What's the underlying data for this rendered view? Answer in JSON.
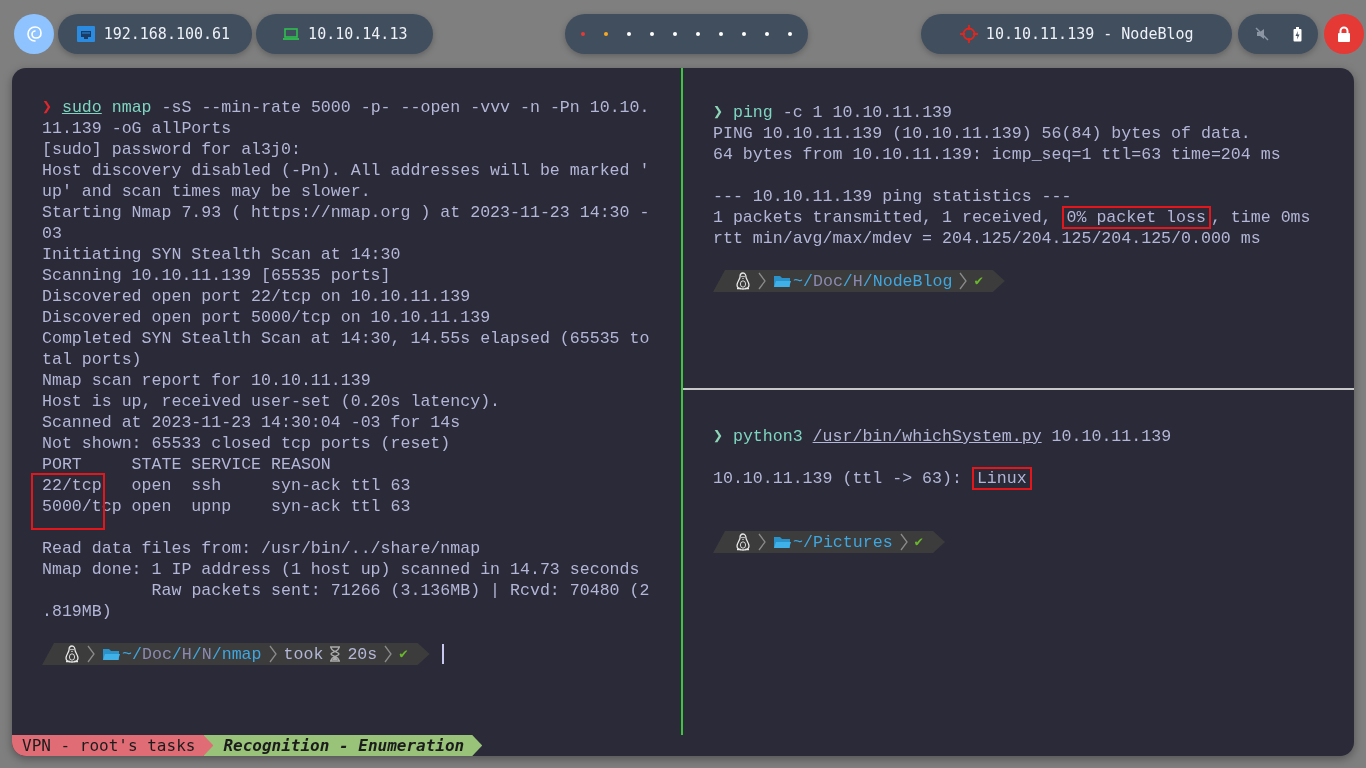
{
  "topbar": {
    "ip_address": "192.168.100.61",
    "vpn_address": "10.10.14.13",
    "workspaces": [
      {
        "color": "#e53935"
      },
      {
        "color": "#f9a825"
      },
      {
        "color": "#ffffff"
      },
      {
        "color": "#ffffff"
      },
      {
        "color": "#ffffff"
      },
      {
        "color": "#ffffff"
      },
      {
        "color": "#ffffff"
      },
      {
        "color": "#ffffff"
      },
      {
        "color": "#ffffff"
      },
      {
        "color": "#ffffff"
      }
    ],
    "target": "10.10.11.139 - NodeBlog"
  },
  "panes": [
    {
      "lines": [
        {
          "kind": "command",
          "prompt": "❯",
          "color": "#e0262b",
          "tokens": [
            {
              "kind": "cmd_link",
              "text": "sudo"
            },
            {
              "kind": "cmd",
              "text": "nmap"
            },
            {
              "kind": "arg",
              "text": "-sS --min-rate 5000 -p- --open -vvv -n -Pn 10.10.11.139 -oG allPorts"
            }
          ]
        },
        {
          "kind": "text",
          "text": "[sudo] password for al3j0:"
        },
        {
          "kind": "text",
          "text": "Host discovery disabled (-Pn). All addresses will be marked 'up' and scan times may be slower."
        },
        {
          "kind": "text",
          "text": "Starting Nmap 7.93 ( https://nmap.org ) at 2023-11-23 14:30 -03"
        },
        {
          "kind": "text",
          "text": "Initiating SYN Stealth Scan at 14:30"
        },
        {
          "kind": "text",
          "text": "Scanning 10.10.11.139 [65535 ports]"
        },
        {
          "kind": "text",
          "text": "Discovered open port 22/tcp on 10.10.11.139"
        },
        {
          "kind": "text",
          "text": "Discovered open port 5000/tcp on 10.10.11.139"
        },
        {
          "kind": "text",
          "text": "Completed SYN Stealth Scan at 14:30, 14.55s elapsed (65535 total ports)"
        },
        {
          "kind": "text",
          "text": "Nmap scan report for 10.10.11.139"
        },
        {
          "kind": "text",
          "text": "Host is up, received user-set (0.20s latency)."
        },
        {
          "kind": "text",
          "text": "Scanned at 2023-11-23 14:30:04 -03 for 14s"
        },
        {
          "kind": "text",
          "text": "Not shown: 65533 closed tcp ports (reset)"
        },
        {
          "kind": "ports",
          "boxed": true,
          "header": "PORT     STATE SERVICE REASON",
          "rows": [
            "22/tcp   open  ssh     syn-ack ttl 63",
            "5000/tcp open  upnp    syn-ack ttl 63"
          ]
        },
        {
          "kind": "blank"
        },
        {
          "kind": "text",
          "text": "Read data files from: /usr/bin/../share/nmap"
        },
        {
          "kind": "text",
          "text": "Nmap done: 1 IP address (1 host up) scanned in 14.73 seconds"
        },
        {
          "kind": "text",
          "text": "           Raw packets sent: 71266 (3.136MB) | Rcvd: 70480 (2.819MB)"
        },
        {
          "kind": "blank"
        },
        {
          "kind": "powerline",
          "path": "~/Doc/H/N/",
          "dir": "nmap",
          "took": "took",
          "duration": "20s",
          "status": "✔",
          "cursor": true
        }
      ]
    },
    {
      "lines": [
        {
          "kind": "command",
          "prompt": "❯",
          "color": "#8fd6b8",
          "tokens": [
            {
              "kind": "cmd",
              "text": "ping"
            },
            {
              "kind": "arg",
              "text": "-c 1 10.10.11.139"
            }
          ]
        },
        {
          "kind": "text",
          "text": "PING 10.10.11.139 (10.10.11.139) 56(84) bytes of data."
        },
        {
          "kind": "text",
          "text": "64 bytes from 10.10.11.139: icmp_seq=1 ttl=63 time=204 ms"
        },
        {
          "kind": "blank"
        },
        {
          "kind": "text",
          "text": "--- 10.10.11.139 ping statistics ---"
        },
        {
          "kind": "parts",
          "parts": [
            {
              "text": "1 packets transmitted, 1 received, ",
              "boxed": false
            },
            {
              "text": "0% packet loss",
              "boxed": true
            },
            {
              "text": ", time 0ms",
              "boxed": false
            }
          ]
        },
        {
          "kind": "text",
          "text": "rtt min/avg/max/mdev = 204.125/204.125/204.125/0.000 ms"
        },
        {
          "kind": "blank"
        },
        {
          "kind": "powerline",
          "path": "~/Doc/H/",
          "dir": "NodeBlog",
          "status": "✔",
          "cursor": false
        }
      ]
    },
    {
      "lines": [
        {
          "kind": "command",
          "prompt": "❯",
          "color": "#8fd6b8",
          "tokens": [
            {
              "kind": "cmd",
              "text": "python3"
            },
            {
              "kind": "path",
              "text": "/usr/bin/whichSystem.py"
            },
            {
              "kind": "arg",
              "text": "10.10.11.139"
            }
          ]
        },
        {
          "kind": "blank"
        },
        {
          "kind": "parts",
          "parts": [
            {
              "text": "10.10.11.139 (ttl -> 63): ",
              "boxed": false
            },
            {
              "text": "Linux",
              "boxed": true
            }
          ]
        },
        {
          "kind": "blank"
        },
        {
          "kind": "blank"
        },
        {
          "kind": "powerline",
          "path": "~/",
          "dir": "Pictures",
          "status": "✔",
          "cursor": false
        }
      ]
    }
  ],
  "status_bar": [
    {
      "label": "VPN - root's tasks",
      "selected": false
    },
    {
      "label": "Recognition - Enumeration",
      "selected": true
    }
  ]
}
